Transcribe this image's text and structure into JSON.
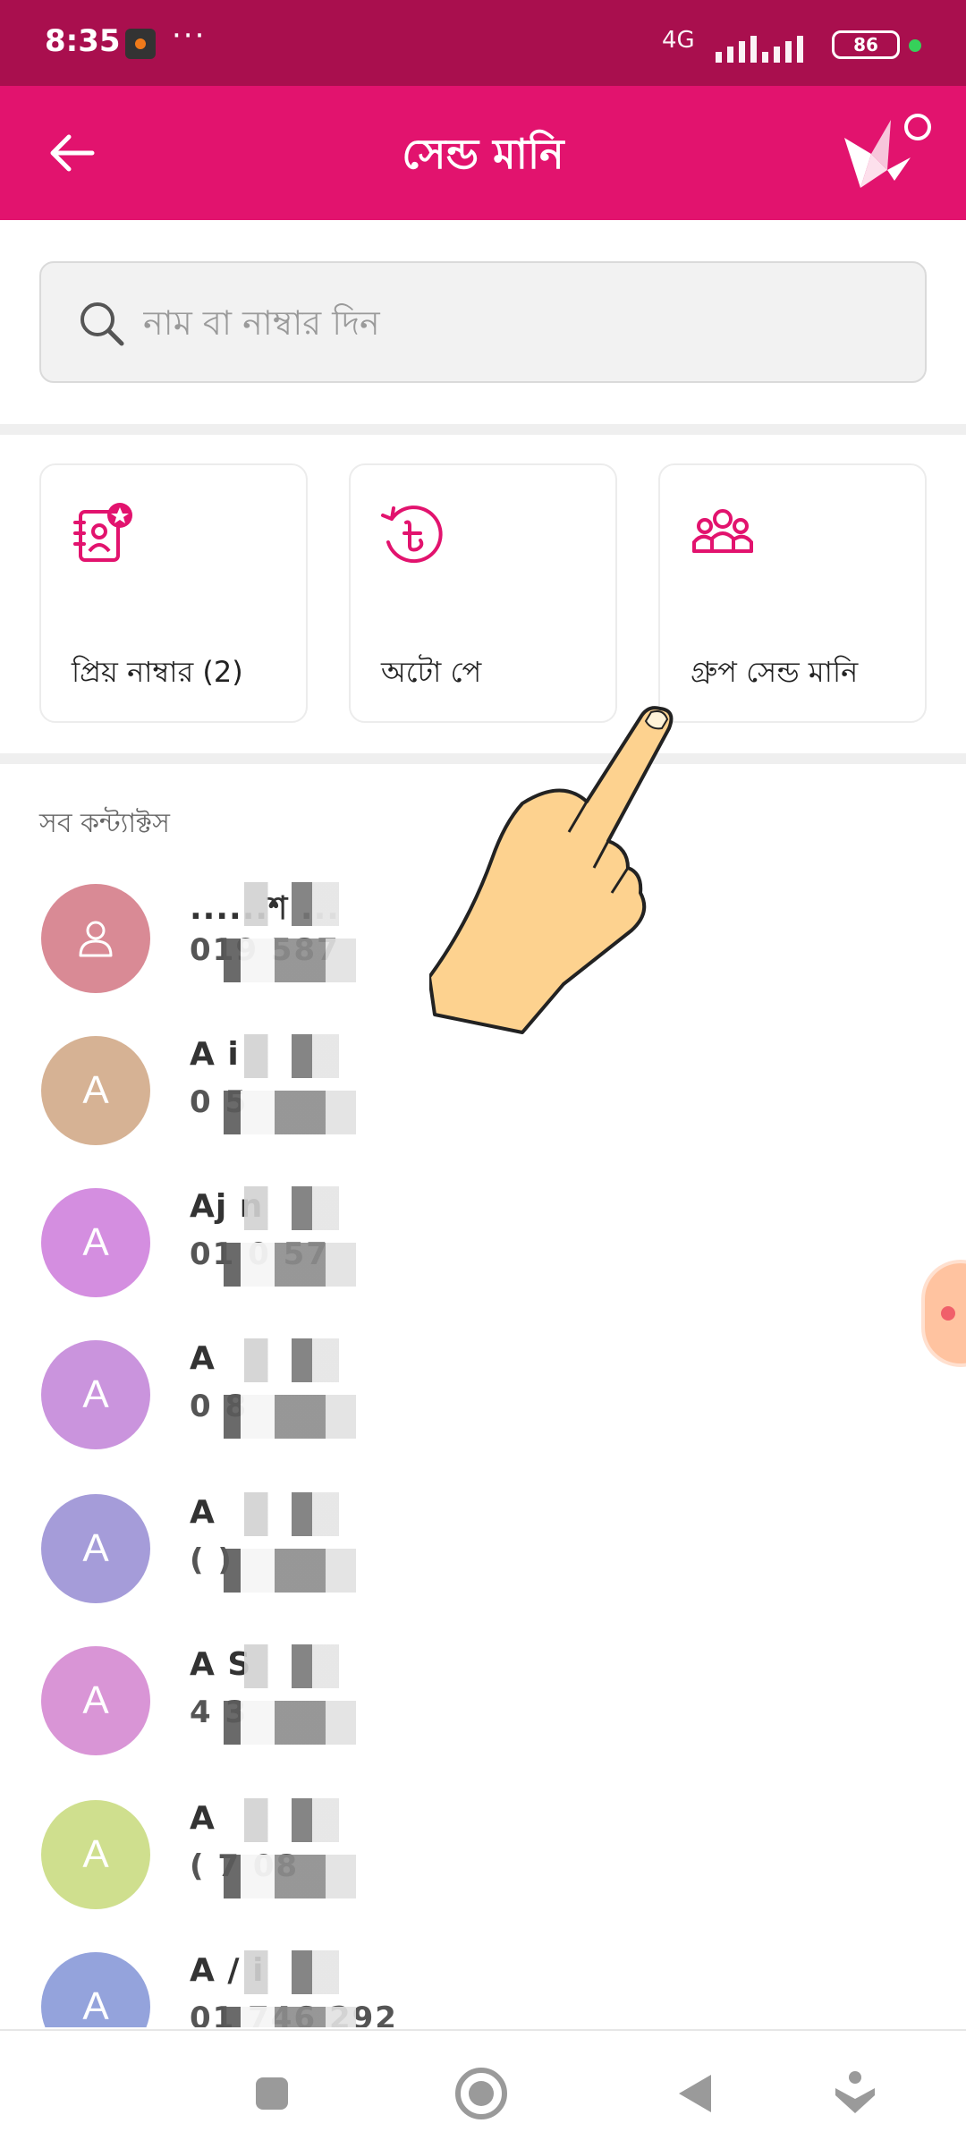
{
  "status_bar": {
    "time": "8:35",
    "dots": "···",
    "network": "4G",
    "battery": "86"
  },
  "header": {
    "title": "সেন্ড মানি"
  },
  "search": {
    "placeholder": "নাম বা নাম্বার দিন"
  },
  "cards": [
    {
      "label": "প্রিয় নাম্বার (2)",
      "icon": "favorite-contacts-icon"
    },
    {
      "label": "অটো পে",
      "icon": "auto-pay-icon"
    },
    {
      "label": "গ্রুপ সেন্ড মানি",
      "icon": "group-send-icon"
    }
  ],
  "section": {
    "title": "সব কন্ট্যাক্টস"
  },
  "contacts": [
    {
      "initial": "",
      "name": "......শ   ...",
      "phone": "019      587",
      "color": "#d98a95"
    },
    {
      "initial": "A",
      "name": "A   i",
      "phone": "0       5",
      "color": "#d6b294"
    },
    {
      "initial": "A",
      "name": "Aj   n",
      "phone": "01    0   57",
      "color": "#d48ee0"
    },
    {
      "initial": "A",
      "name": "A    ",
      "phone": "0      8",
      "color": "#ca94dd"
    },
    {
      "initial": "A",
      "name": "A     ",
      "phone": "(       )",
      "color": "#a59cd9"
    },
    {
      "initial": "A",
      "name": "A       S",
      "phone": "  4     3",
      "color": "#d995d6"
    },
    {
      "initial": "A",
      "name": "A      ",
      "phone": "( 7     08",
      "color": "#cfdf8e"
    },
    {
      "initial": "A",
      "name": "A    /  i",
      "phone": "01  746  292",
      "color": "#94a3dc"
    }
  ],
  "colors": {
    "primary": "#e2136e",
    "status_bar": "#a90f4e"
  }
}
